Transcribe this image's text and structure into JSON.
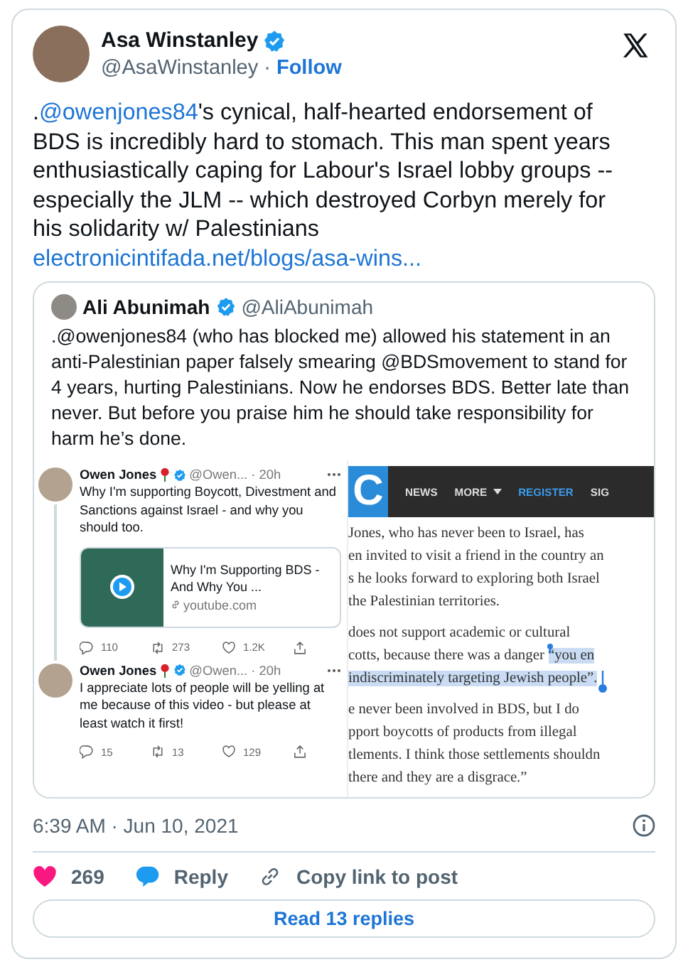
{
  "author": {
    "name": "Asa Winstanley",
    "verified": true,
    "handle": "@AsaWinstanley",
    "separator": "·",
    "follow": "Follow"
  },
  "text_parts": [
    {
      "kind": "plain",
      "text": "."
    },
    {
      "kind": "mention",
      "text": "@owenjones84"
    },
    {
      "kind": "plain",
      "text": "'s cynical, half-hearted endorsement of BDS is incredibly hard to stomach. This man spent years enthusiastically caping for Labour's Israel lobby groups -- especially the JLM -- which destroyed Corbyn merely for his solidarity w/ Palestinians "
    },
    {
      "kind": "link",
      "text": "electronicintifada.net/blogs/asa-wins..."
    }
  ],
  "quote": {
    "name": "Ali Abunimah",
    "verified": true,
    "handle": "@AliAbunimah",
    "text": ".@owenjones84 (who has blocked me) allowed his statement in an anti-Palestinian paper falsely smearing @BDSmovement to stand for 4 years, hurting Palestinians. Now he endorses BDS. Better late than never. But before you praise him he should take responsibility for harm he’s done.",
    "screenshot": {
      "tweets": [
        {
          "name": "Owen Jones",
          "verified": true,
          "handle_time": "@Owen... · 20h",
          "text": "Why I'm supporting Boycott, Divestment and Sanctions against Israel - and why you should too.",
          "card": {
            "title": "Why I'm Supporting BDS - And Why You ...",
            "domain": "youtube.com"
          },
          "stats": [
            "110",
            "273",
            "1.2K"
          ]
        },
        {
          "name": "Owen Jones",
          "verified": true,
          "handle_time": "@Owen... · 20h",
          "text": "I appreciate lots of people will be yelling at me because of this video - but please at least watch it first!",
          "stats": [
            "15",
            "13",
            "129"
          ]
        }
      ],
      "article": {
        "logo": "C",
        "nav": [
          {
            "kind": "plain",
            "text": "NEWS"
          },
          {
            "kind": "menu",
            "text": "MORE"
          },
          {
            "kind": "accent",
            "text": "REGISTER"
          },
          {
            "kind": "plain",
            "text": "SIG"
          }
        ],
        "paragraphs": [
          [
            [
              {
                "text": "Jones, who has never been to Israel, has",
                "highlighted": false
              }
            ],
            [
              {
                "text": "en invited to visit a friend in the country an",
                "highlighted": false
              }
            ],
            [
              {
                "text": "s he looks forward to exploring both Israel",
                "highlighted": false
              }
            ],
            [
              {
                "text": "the Palestinian territories.",
                "highlighted": false
              }
            ]
          ],
          [
            [
              {
                "text": "does not support academic or cultural",
                "highlighted": false
              }
            ],
            [
              {
                "text": "cotts, because there was a danger ",
                "highlighted": false
              },
              {
                "text": "“you en",
                "highlighted": true
              }
            ],
            [
              {
                "text": "indiscriminately targeting Jewish people”.",
                "highlighted": true
              }
            ]
          ],
          [
            [
              {
                "text": "e never been involved in BDS, but I do",
                "highlighted": false
              }
            ],
            [
              {
                "text": "pport boycotts of products from illegal",
                "highlighted": false
              }
            ],
            [
              {
                "text": "tlements. I think those settlements shouldn",
                "highlighted": false
              }
            ],
            [
              {
                "text": "there and they are a disgrace.”",
                "highlighted": false
              }
            ]
          ]
        ]
      }
    }
  },
  "timestamp": "6:39 AM · Jun 10, 2021",
  "actions": [
    {
      "kind": "like",
      "label": "269"
    },
    {
      "kind": "reply",
      "label": "Reply"
    },
    {
      "kind": "copy",
      "label": "Copy link to post"
    }
  ],
  "read_button": "Read 13 replies"
}
